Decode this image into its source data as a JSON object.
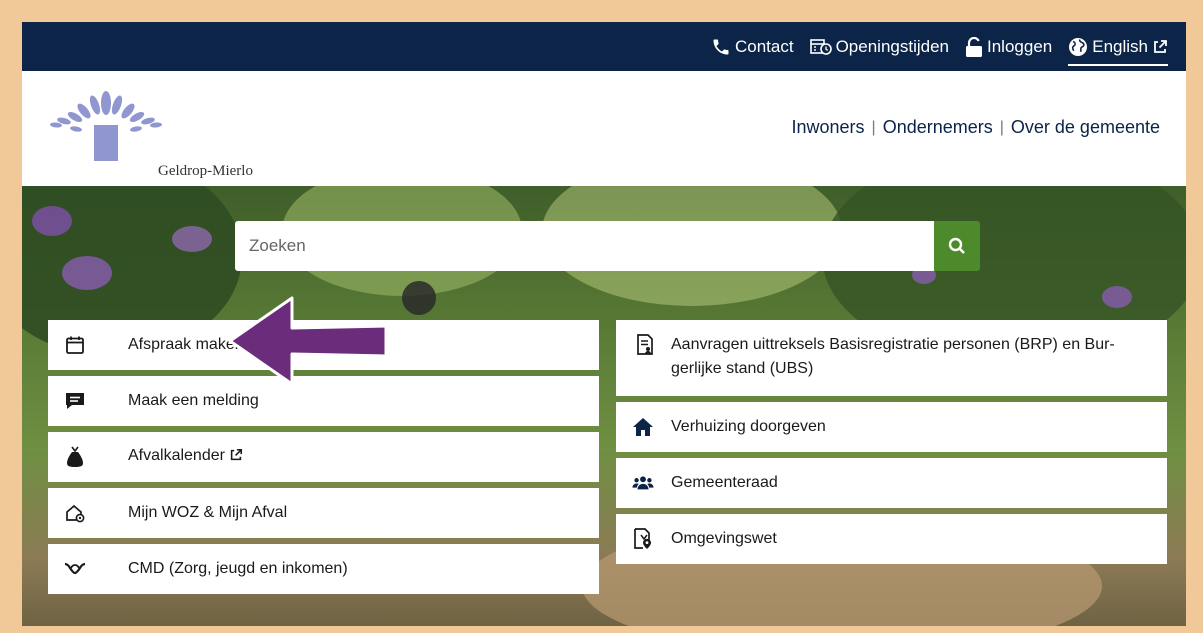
{
  "topbar": {
    "links": [
      {
        "label": "Contact",
        "icon": "phone-icon"
      },
      {
        "label": "Openingstijden",
        "icon": "clock-calendar-icon"
      },
      {
        "label": "Inloggen",
        "icon": "unlock-icon"
      },
      {
        "label": "English",
        "icon": "globe-icon",
        "external": true
      }
    ]
  },
  "header": {
    "logo_text": "Geldrop-Mierlo",
    "nav": [
      "Inwoners",
      "Ondernemers",
      "Over de gemeente"
    ]
  },
  "search": {
    "placeholder": "Zoeken",
    "button_icon": "search-icon"
  },
  "tiles_left": [
    {
      "label": "Afspraak maken",
      "icon": "calendar-icon"
    },
    {
      "label": "Maak een melding",
      "icon": "message-icon"
    },
    {
      "label": "Afvalkalender",
      "icon": "waste-bag-icon",
      "external": true
    },
    {
      "label": "Mijn WOZ & Mijn Afval",
      "icon": "house-settings-icon"
    },
    {
      "label": "CMD (Zorg, jeugd en inkomen)",
      "icon": "care-hands-icon"
    }
  ],
  "tiles_right": [
    {
      "label": "Aanvragen uittreksels Basisregistratie personen (BRP) en Bur-gerlijke stand (UBS)",
      "icon": "document-person-icon"
    },
    {
      "label": "Verhuizing doorgeven",
      "icon": "home-icon"
    },
    {
      "label": "Gemeenteraad",
      "icon": "group-icon"
    },
    {
      "label": "Omgevingswet",
      "icon": "document-location-icon"
    }
  ],
  "colors": {
    "topbar": "#0b2447",
    "search_button": "#4d8a2b",
    "arrow": "#6b2d7b",
    "logo": "#8f96d0",
    "frame": "#f1c999"
  }
}
